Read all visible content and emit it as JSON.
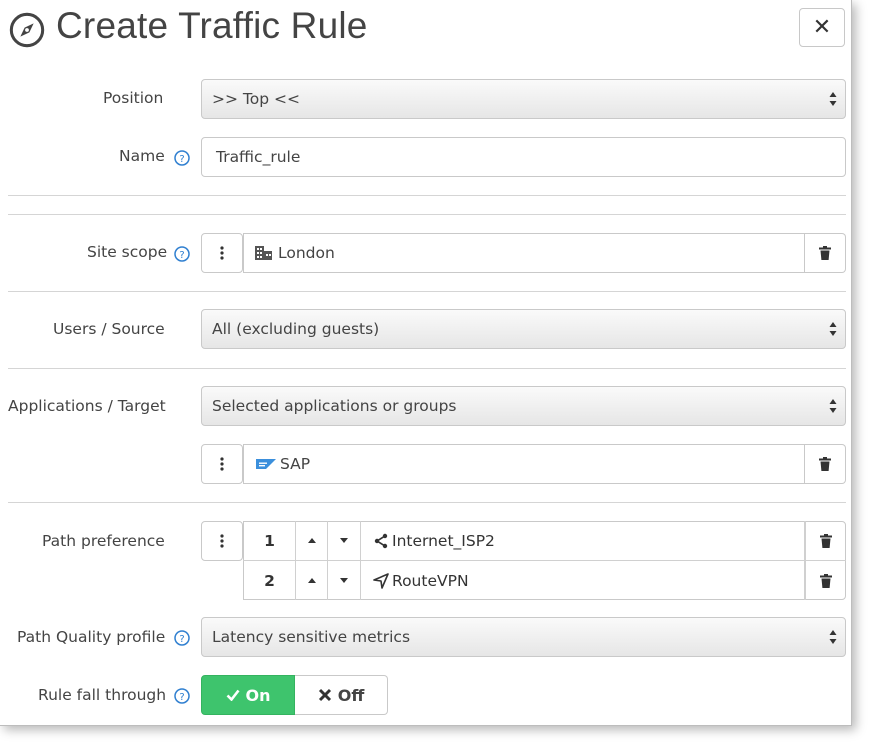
{
  "dialog": {
    "title": "Create Traffic Rule",
    "close_glyph": "✕"
  },
  "position": {
    "label": "Position",
    "value": ">> Top <<"
  },
  "name": {
    "label": "Name",
    "value": "Traffic_rule"
  },
  "site_scope": {
    "label": "Site scope",
    "value": "London",
    "icon": "building-icon"
  },
  "users_source": {
    "label": "Users / Source",
    "value": "All (excluding guests)"
  },
  "applications_target": {
    "label": "Applications / Target",
    "value": "Selected applications or groups",
    "items": [
      {
        "name": "SAP",
        "icon": "sap-logo-icon"
      }
    ]
  },
  "path_preference": {
    "label": "Path preference",
    "items": [
      {
        "order": "1",
        "name": "Internet_ISP2",
        "icon": "share-icon"
      },
      {
        "order": "2",
        "name": "RouteVPN",
        "icon": "location-arrow-icon"
      }
    ]
  },
  "path_quality": {
    "label": "Path Quality profile",
    "value": "Latency sensitive metrics"
  },
  "rule_fall_through": {
    "label": "Rule fall through",
    "on_label": "On",
    "off_label": "Off",
    "state": "on"
  },
  "colors": {
    "accent": "#2f7fd0",
    "toggle_on": "#3ec46d"
  }
}
